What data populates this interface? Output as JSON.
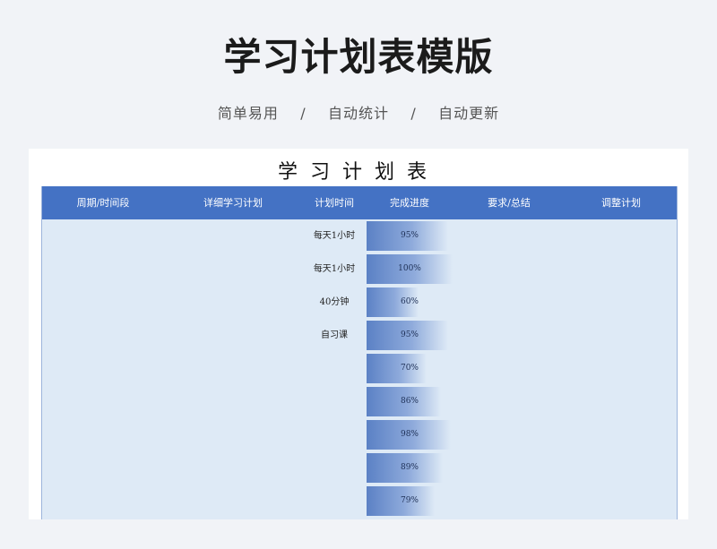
{
  "header": {
    "title": "学习计划表模版",
    "subtitle_parts": [
      "简单易用",
      "/",
      "自动统计",
      "/",
      "自动更新"
    ]
  },
  "sheet": {
    "title": "学习计划表",
    "columns": [
      "周期/时间段",
      "详细学习计划",
      "计划时间",
      "完成进度",
      "要求/总结",
      "调整计划"
    ],
    "rows": [
      {
        "period": "",
        "plan": "",
        "time": "每天1小时",
        "progress": "95%",
        "progress_value": 0.95,
        "summary": "",
        "adjust": ""
      },
      {
        "period": "",
        "plan": "",
        "time": "每天1小时",
        "progress": "100%",
        "progress_value": 1.0,
        "summary": "",
        "adjust": ""
      },
      {
        "period": "",
        "plan": "",
        "time": "40分钟",
        "progress": "60%",
        "progress_value": 0.6,
        "summary": "",
        "adjust": ""
      },
      {
        "period": "",
        "plan": "",
        "time": "自习课",
        "progress": "95%",
        "progress_value": 0.95,
        "summary": "",
        "adjust": ""
      },
      {
        "period": "",
        "plan": "",
        "time": "",
        "progress": "70%",
        "progress_value": 0.7,
        "summary": "",
        "adjust": ""
      },
      {
        "period": "",
        "plan": "",
        "time": "",
        "progress": "86%",
        "progress_value": 0.86,
        "summary": "",
        "adjust": ""
      },
      {
        "period": "",
        "plan": "",
        "time": "",
        "progress": "98%",
        "progress_value": 0.98,
        "summary": "",
        "adjust": ""
      },
      {
        "period": "",
        "plan": "",
        "time": "",
        "progress": "89%",
        "progress_value": 0.89,
        "summary": "",
        "adjust": ""
      },
      {
        "period": "",
        "plan": "",
        "time": "",
        "progress": "79%",
        "progress_value": 0.79,
        "summary": "",
        "adjust": ""
      }
    ]
  },
  "colors": {
    "header_bg": "#4472c4",
    "body_bg": "#deeaf6",
    "bar_start": "#5b81c5",
    "bar_end": "#8eaadb"
  }
}
